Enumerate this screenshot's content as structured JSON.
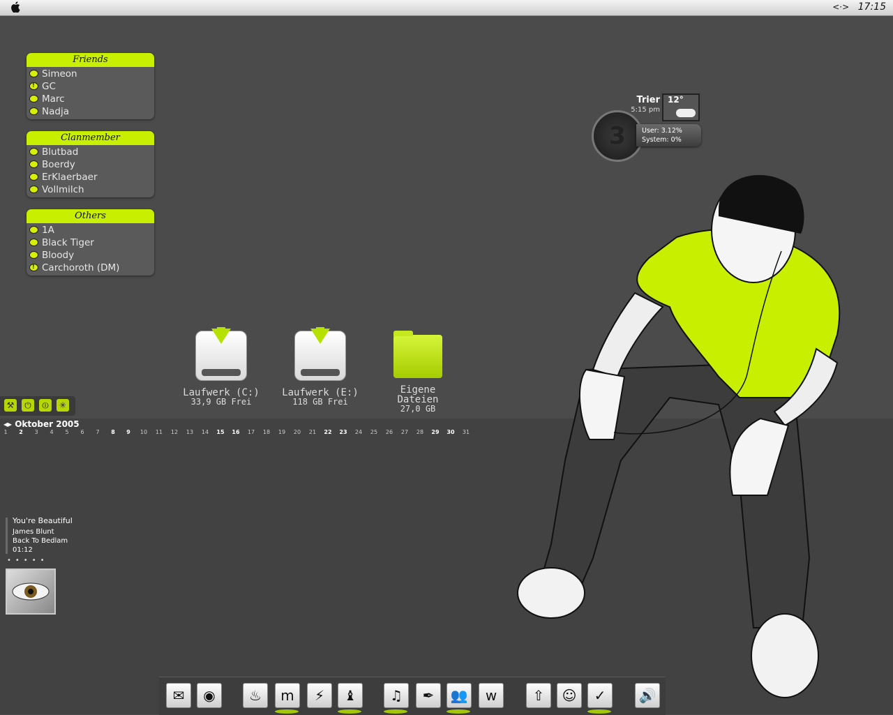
{
  "menubar": {
    "apple": "",
    "clock": "17:15",
    "arrows": "<·>"
  },
  "buddy_groups": [
    {
      "title": "Friends",
      "buddies": [
        {
          "name": "Simeon",
          "alert": false
        },
        {
          "name": "GC",
          "alert": true
        },
        {
          "name": "Marc",
          "alert": false
        },
        {
          "name": "Nadja",
          "alert": false
        }
      ]
    },
    {
      "title": "Clanmember",
      "buddies": [
        {
          "name": "Blutbad",
          "alert": false
        },
        {
          "name": "Boerdy",
          "alert": false
        },
        {
          "name": "ErKlaerbaer",
          "alert": false
        },
        {
          "name": "Vollmilch",
          "alert": false
        }
      ]
    },
    {
      "title": "Others",
      "buddies": [
        {
          "name": "1A",
          "alert": false
        },
        {
          "name": "Black Tiger",
          "alert": false
        },
        {
          "name": "Bloody",
          "alert": false
        },
        {
          "name": "Carchoroth (DM)",
          "alert": true
        }
      ]
    }
  ],
  "drives": [
    {
      "label": "Laufwerk (C:)",
      "sub": "33,9 GB Frei",
      "type": "drive"
    },
    {
      "label": "Laufwerk (E:)",
      "sub": "118 GB Frei",
      "type": "drive"
    },
    {
      "label": "Eigene Dateien",
      "sub": "27,0 GB",
      "type": "folder"
    }
  ],
  "weather": {
    "city": "Trier",
    "time": "5:15 pm",
    "temp": "12°",
    "icon": "partly-cloudy-icon"
  },
  "cpu": {
    "user": "User: 3.12%",
    "system": "System: 0%",
    "clock_digit": "3"
  },
  "button_row": [
    {
      "icon": "wrench-icon",
      "glyph": "⚒"
    },
    {
      "icon": "power-icon",
      "glyph": "⏻"
    },
    {
      "icon": "standby-icon",
      "glyph": "⏼"
    },
    {
      "icon": "restart-icon",
      "glyph": "✳"
    }
  ],
  "calendar": {
    "month": "Oktober 2005",
    "nav": "◂▸",
    "days": [
      "1",
      "2",
      "3",
      "4",
      "5",
      "6",
      "7",
      "8",
      "9",
      "10",
      "11",
      "12",
      "13",
      "14",
      "15",
      "16",
      "17",
      "18",
      "19",
      "20",
      "21",
      "22",
      "23",
      "24",
      "25",
      "26",
      "27",
      "28",
      "29",
      "30",
      "31"
    ],
    "weekend": [
      "2",
      "8",
      "9",
      "15",
      "16",
      "22",
      "23",
      "29",
      "30"
    ]
  },
  "now_playing": {
    "title": "You're Beautiful",
    "artist": "James Blunt",
    "album": "Back To Bedlam",
    "time": "01:12",
    "dots": "•••••"
  },
  "dock": [
    {
      "name": "mail-icon",
      "glyph": "✉"
    },
    {
      "name": "firefox-icon",
      "glyph": "◉"
    },
    {
      "name": "flame-icon",
      "glyph": "♨"
    },
    {
      "name": "messenger-icon",
      "glyph": "m"
    },
    {
      "name": "winamp-icon",
      "glyph": "⚡"
    },
    {
      "name": "tool-icon",
      "glyph": "♝"
    },
    {
      "name": "music-icon",
      "glyph": "♫"
    },
    {
      "name": "feather-icon",
      "glyph": "✒"
    },
    {
      "name": "users-icon",
      "glyph": "👥"
    },
    {
      "name": "word-icon",
      "glyph": "w"
    },
    {
      "name": "upload-icon",
      "glyph": "⇧"
    },
    {
      "name": "finder-icon",
      "glyph": "☺"
    },
    {
      "name": "nike-icon",
      "glyph": "✓"
    },
    {
      "name": "volume-icon",
      "glyph": "🔊"
    }
  ],
  "colors": {
    "accent": "#c8ef00",
    "background": "#4b4b4b",
    "lower_band": "#424242"
  }
}
